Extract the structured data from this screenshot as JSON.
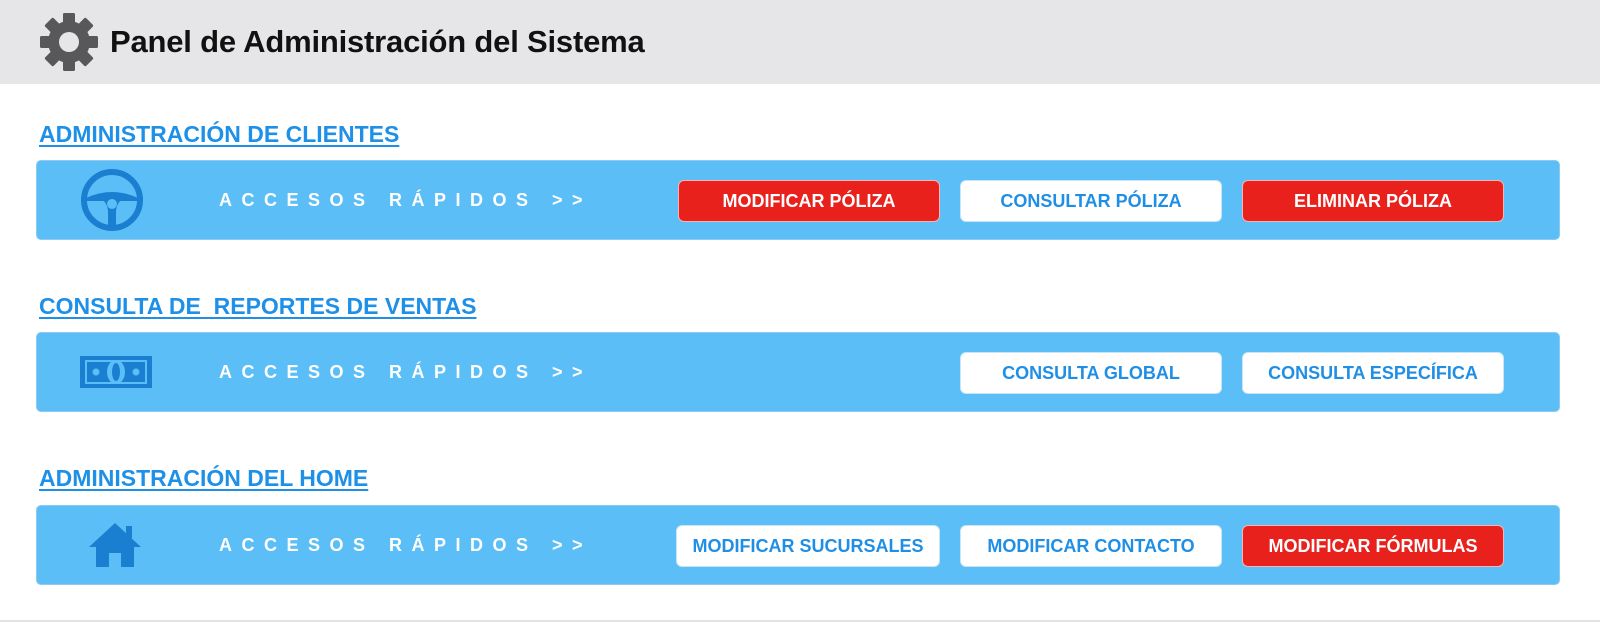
{
  "header": {
    "icon": "gear-icon",
    "title": "Panel de Administración del Sistema"
  },
  "sections": [
    {
      "title": "ADMINISTRACIÓN DE CLIENTES",
      "icon": "steering-wheel-icon",
      "quick_label": "ACCESOS RÁPIDOS >>",
      "buttons": [
        {
          "label": "MODIFICAR PÓLIZA",
          "style": "red"
        },
        {
          "label": "CONSULTAR PÓLIZA",
          "style": "white"
        },
        {
          "label": "ELIMINAR PÓLIZA",
          "style": "red"
        }
      ]
    },
    {
      "title": "CONSULTA DE  REPORTES DE VENTAS",
      "icon": "money-bill-icon",
      "quick_label": "ACCESOS RÁPIDOS >>",
      "buttons": [
        {
          "label": "CONSULTA GLOBAL",
          "style": "white"
        },
        {
          "label": "CONSULTA ESPECÍFICA",
          "style": "white"
        }
      ]
    },
    {
      "title": "ADMINISTRACIÓN DEL HOME",
      "icon": "home-icon",
      "quick_label": "ACCESOS RÁPIDOS >>",
      "buttons": [
        {
          "label": "MODIFICAR SUCURSALES",
          "style": "white"
        },
        {
          "label": "MODIFICAR CONTACTO",
          "style": "white"
        },
        {
          "label": "MODIFICAR FÓRMULAS",
          "style": "red"
        }
      ]
    }
  ],
  "colors": {
    "header_bg": "#e6e5e8",
    "band_bg": "#5bbef7",
    "link_blue": "#1e90e8",
    "button_red": "#e8211c",
    "icon_blue": "#1a7fd0"
  }
}
